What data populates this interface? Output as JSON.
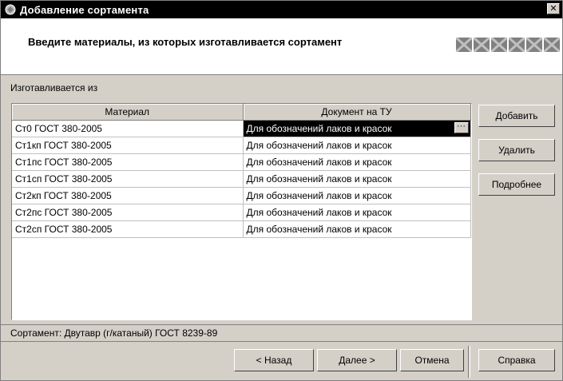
{
  "window": {
    "title": "Добавление сортамента",
    "close_label": "✕"
  },
  "header": {
    "heading": "Введите материалы, из которых изготавливается сортамент",
    "step_icons": [
      "step-icon",
      "step-icon",
      "step-icon",
      "step-icon",
      "step-icon",
      "step-icon"
    ]
  },
  "section_label": "Изготавливается из",
  "grid": {
    "columns": [
      "Материал",
      "Документ на ТУ"
    ],
    "rows": [
      {
        "material": "Ст0 ГОСТ 380-2005",
        "doc": "Для обозначений лаков и красок"
      },
      {
        "material": "Ст1кп ГОСТ 380-2005",
        "doc": "Для обозначений лаков и красок"
      },
      {
        "material": "Ст1пс ГОСТ 380-2005",
        "doc": "Для обозначений лаков и красок"
      },
      {
        "material": "Ст1сп ГОСТ 380-2005",
        "doc": "Для обозначений лаков и красок"
      },
      {
        "material": "Ст2кп ГОСТ 380-2005",
        "doc": "Для обозначений лаков и красок"
      },
      {
        "material": "Ст2пс ГОСТ 380-2005",
        "doc": "Для обозначений лаков и красок"
      },
      {
        "material": "Ст2сп ГОСТ 380-2005",
        "doc": "Для обозначений лаков и красок"
      }
    ],
    "ellipsis": "···"
  },
  "side_buttons": {
    "add": "Добавить",
    "delete": "Удалить",
    "details": "Подробнее"
  },
  "status": "Сортамент: Двутавр (г/катаный) ГОСТ 8239-89",
  "bottom_buttons": {
    "back": "< Назад",
    "next": "Далее >",
    "cancel": "Отмена",
    "help": "Справка"
  },
  "colors": {
    "face": "#d4d0c8",
    "titlebar": "#000000",
    "selection": "#000000"
  }
}
